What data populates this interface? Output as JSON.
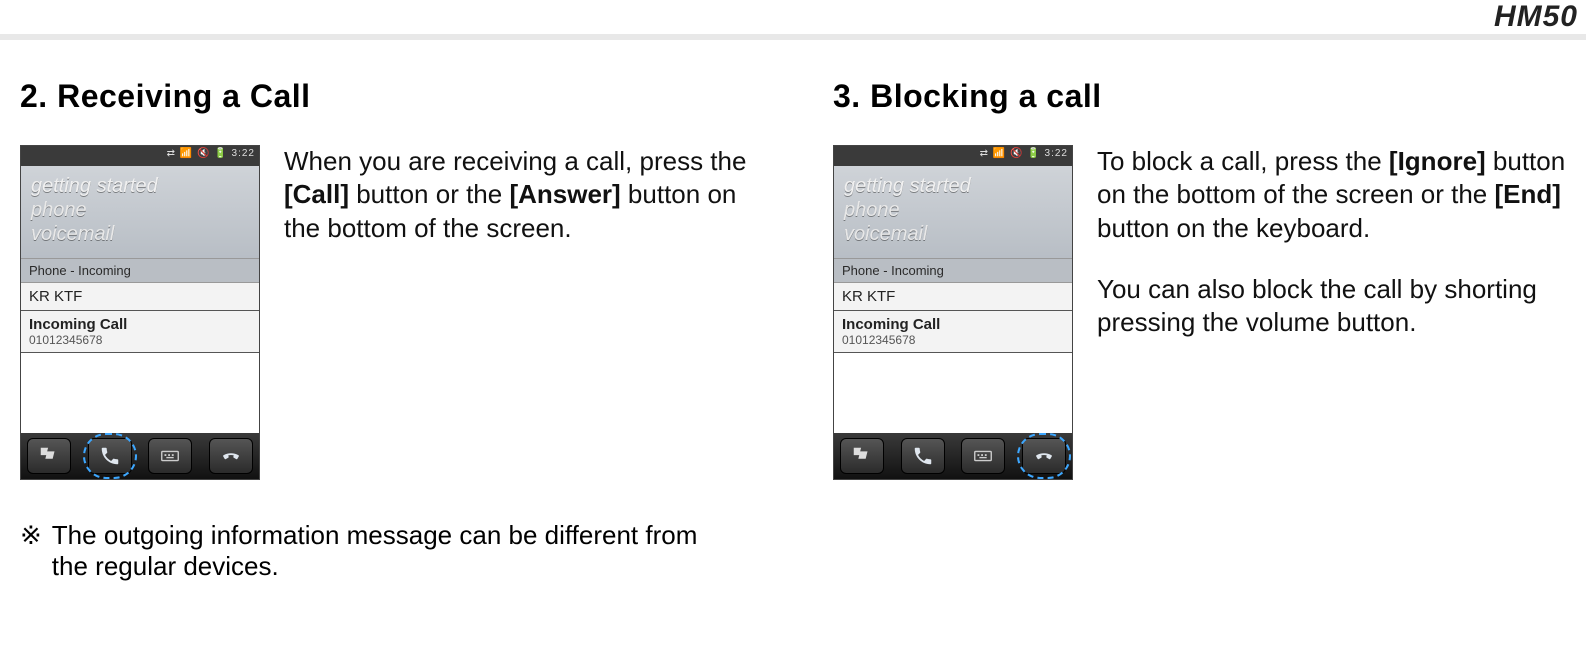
{
  "header": {
    "model": "HM50"
  },
  "sections": {
    "left": {
      "heading": "2. Receiving a Call",
      "desc_html": "When you are receiving a call, press the <b>[Call]</b> button or the <b>[Answer]</b> button on the bottom of the screen.",
      "footnote_symbol": "※",
      "footnote_text": "The outgoing information message can be different from the regular devices."
    },
    "right": {
      "heading": "3. Blocking a call",
      "desc_html_p1": "To block a call, press the <b>[Ignore]</b> button on the bottom of the screen or the <b>[End]</b> button on the keyboard.",
      "desc_html_p2": "You can also block the call by shorting pressing the volume button."
    }
  },
  "phone": {
    "status_time": "3:22",
    "home_lines": [
      "getting started",
      "phone",
      "voicemail"
    ],
    "panel_title": "Phone - Incoming",
    "carrier": "KR KTF",
    "incoming_label": "Incoming Call",
    "incoming_number": "01012345678",
    "softbar_order": [
      "start",
      "call",
      "keyboard",
      "end"
    ],
    "highlight_left": "call",
    "highlight_right": "end"
  },
  "icons": {
    "start": "start-flag-icon",
    "call": "phone-answer-icon",
    "keyboard": "keyboard-icon",
    "end": "phone-end-icon"
  }
}
